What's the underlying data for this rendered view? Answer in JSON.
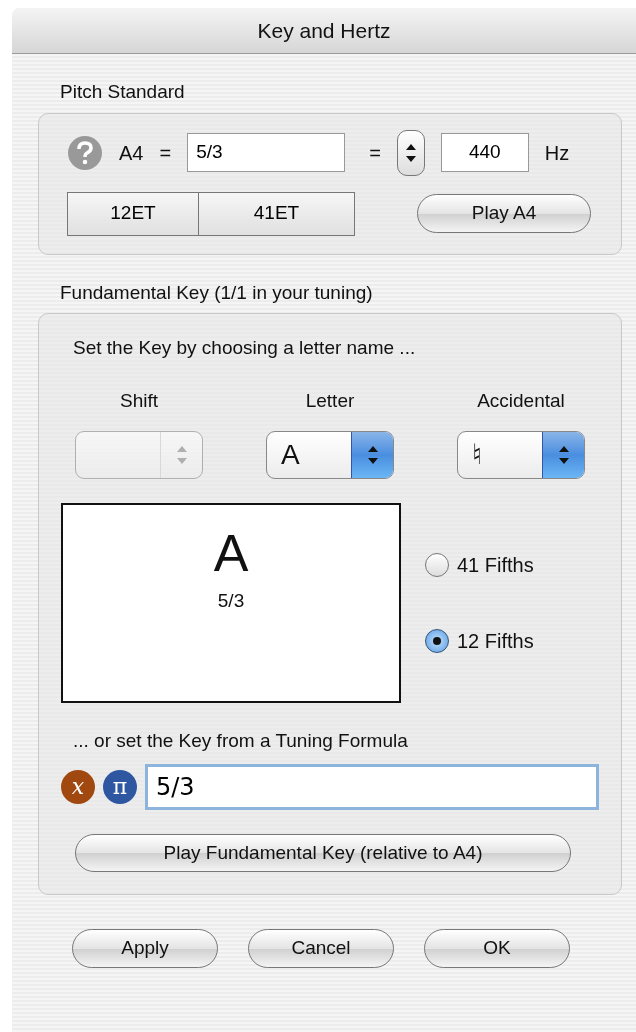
{
  "window": {
    "title": "Key and Hertz"
  },
  "pitch_standard": {
    "label": "Pitch Standard",
    "a4_label": "A4",
    "equals_1": "=",
    "ratio_value": "5/3",
    "equals_2": "=",
    "hz_value": "440",
    "hz_unit": "Hz",
    "segments": [
      {
        "label": "12ET"
      },
      {
        "label": "41ET"
      }
    ],
    "play_button": "Play A4"
  },
  "fundamental_key": {
    "label": "Fundamental Key (1/1 in your tuning)",
    "instruction": "Set the Key by choosing a letter name ...",
    "popups": [
      {
        "label": "Shift",
        "disabled": true
      },
      {
        "label": "Letter",
        "value": "A",
        "disabled": false
      },
      {
        "label": "Accidental",
        "value": "♮",
        "disabled": false
      }
    ],
    "display": {
      "letter": "A",
      "ratio": "5/3"
    },
    "radios": [
      {
        "label": "41 Fifths",
        "selected": false
      },
      {
        "label": "12 Fifths",
        "selected": true
      }
    ],
    "formula_label": "... or set the Key from a Tuning Formula",
    "formula_icons": [
      {
        "glyph": "𝑥",
        "color": "#a0480f"
      },
      {
        "glyph": "π",
        "color": "#2f56a0"
      }
    ],
    "formula_value": "5/3",
    "play_button": "Play Fundamental Key (relative to A4)"
  },
  "buttons": [
    "Apply",
    "Cancel",
    "OK"
  ]
}
